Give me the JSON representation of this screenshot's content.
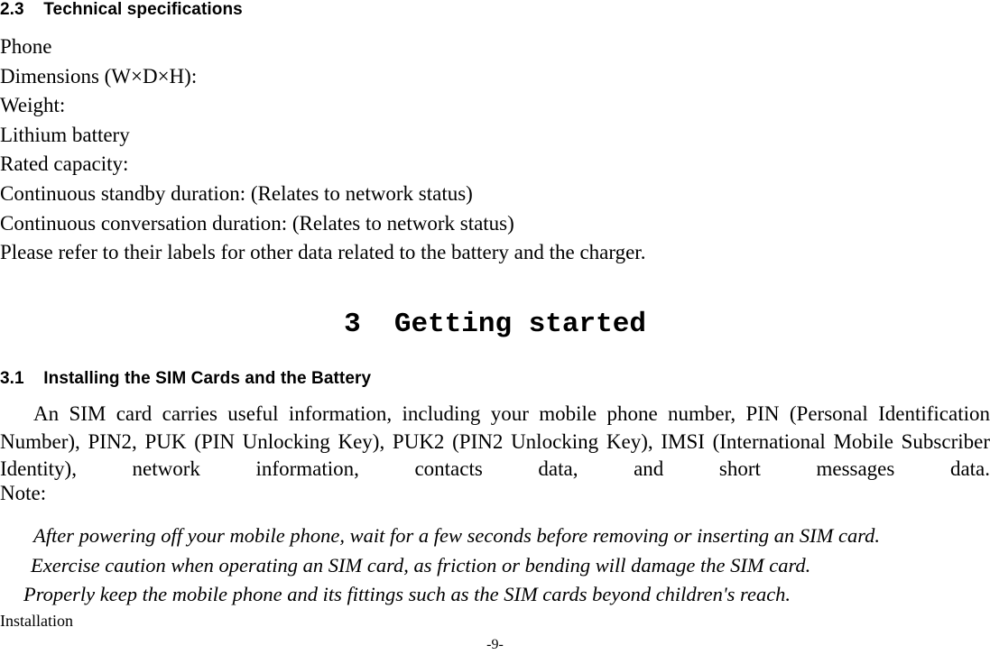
{
  "document": {
    "section_2_3": {
      "number": "2.3",
      "title": "Technical specifications",
      "full": "2.3    Technical specifications"
    },
    "spec_lines": [
      "Phone",
      "Dimensions (W×D×H):",
      "Weight:",
      "Lithium battery",
      "Rated capacity:",
      "Continuous standby duration: (Relates to network status)",
      "Continuous conversation duration: (Relates to network status)",
      "Please refer to their labels for other data related to the battery and the charger."
    ],
    "chapter_3": {
      "number": "3",
      "title": "Getting started",
      "full": "3  Getting started"
    },
    "section_3_1": {
      "number": "3.1",
      "title": "Installing the SIM Cards and the Battery",
      "full": "3.1    Installing the SIM Cards and the Battery"
    },
    "body_paragraph": "An SIM card carries useful information, including your mobile phone number, PIN (Personal Identification Number), PIN2, PUK (PIN Unlocking Key), PUK2 (PIN2 Unlocking Key), IMSI (International Mobile Subscriber Identity), network information, contacts data, and short messages data.",
    "note": {
      "label": "Note:",
      "items": [
        "After powering off your mobile phone, wait for a few seconds before removing or inserting an SIM card.",
        "Exercise caution when operating an SIM card, as friction or bending will damage the SIM card.",
        "Properly keep the mobile phone and its fittings such as the SIM cards beyond children's reach."
      ]
    },
    "footer": {
      "running_head": "Installation",
      "page_number": "-9-"
    }
  }
}
